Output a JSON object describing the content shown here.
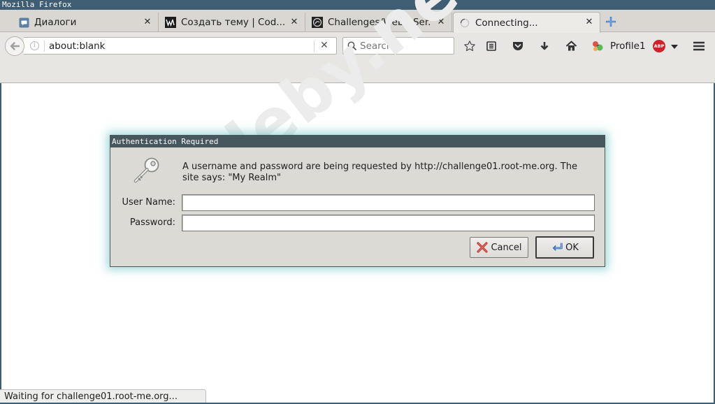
{
  "window": {
    "title": "Mozilla Firefox"
  },
  "tabs": [
    {
      "label": "Диалоги",
      "icon": "chat-bubble-icon"
    },
    {
      "label": "Создать тему | Cod...",
      "icon": "codeby-logo-icon"
    },
    {
      "label": "Challenges/Web - Ser...",
      "icon": "rootme-logo-icon"
    },
    {
      "label": "Connecting...",
      "icon": "loading-spinner-icon",
      "active": true
    }
  ],
  "navbar": {
    "url": "about:blank",
    "search_placeholder": "Search",
    "profile_label": "Profile1",
    "abp_label": "ABP"
  },
  "watermark": "codeby.net",
  "dialog": {
    "title": "Authentication Required",
    "message": "A username and password are being requested by http://challenge01.root-me.org. The site says: \"My Realm\"",
    "username_label": "User Name:",
    "username_value": "",
    "password_label": "Password:",
    "password_value": "",
    "cancel_label": "Cancel",
    "ok_label": "OK"
  },
  "status": {
    "text": "Waiting for challenge01.root-me.org..."
  },
  "colors": {
    "window_frame": "#3f5d73",
    "dialog_title_bg": "#47575e",
    "dialog_bg": "#dcdad5",
    "abp_red": "#d0202a"
  }
}
